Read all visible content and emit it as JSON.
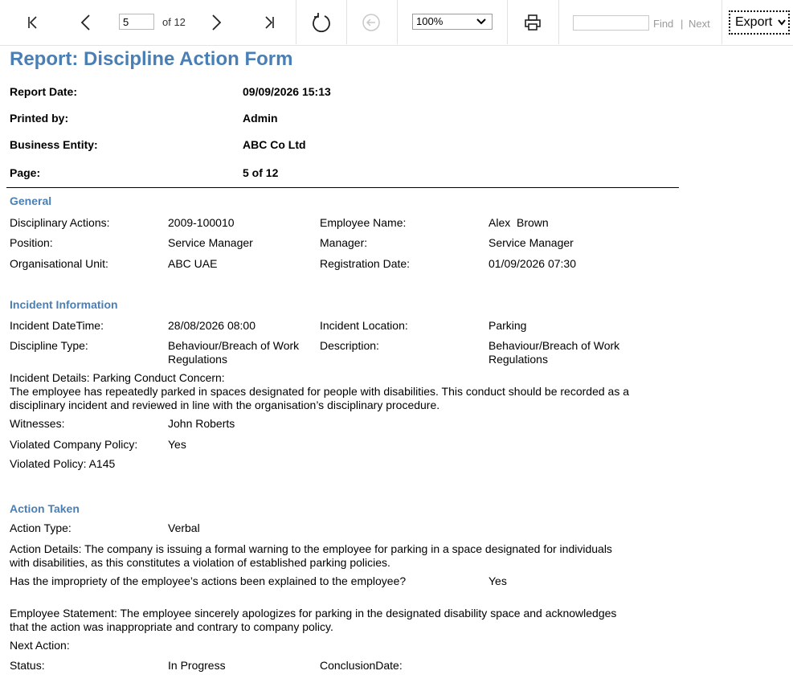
{
  "toolbar": {
    "current_page": "5",
    "page_of": "of 12",
    "zoom": "100%",
    "find_label": "Find",
    "find_separator": "|",
    "next_label": "Next",
    "export_label": "Export"
  },
  "report": {
    "title": "Report: Discipline Action Form",
    "meta": [
      {
        "label": "Report Date:",
        "value": "09/09/2026 15:13"
      },
      {
        "label": "Printed by:",
        "value": "Admin"
      },
      {
        "label": "Business Entity:",
        "value": "ABC Co Ltd"
      },
      {
        "label": "Page:",
        "value": "5 of 12"
      }
    ],
    "general": {
      "heading": "General",
      "disciplinary_actions_label": "Disciplinary Actions:",
      "disciplinary_actions_value": "2009-100010",
      "employee_name_label": "Employee Name:",
      "employee_name_value": "Alex  Brown",
      "position_label": "Position:",
      "position_value": "Service Manager",
      "manager_label": "Manager:",
      "manager_value": "Service Manager",
      "org_unit_label": "Organisational Unit:",
      "org_unit_value": "ABC UAE",
      "registration_date_label": "Registration Date:",
      "registration_date_value": "01/09/2026 07:30"
    },
    "incident": {
      "heading": "Incident Information",
      "datetime_label": "Incident DateTime:",
      "datetime_value": "28/08/2026 08:00",
      "location_label": "Incident Location:",
      "location_value": "Parking",
      "discipline_type_label": "Discipline Type:",
      "discipline_type_value_1": "Behaviour/Breach of Work",
      "discipline_type_value_2": "Regulations",
      "description_label": "Description:",
      "description_value_1": "Behaviour/Breach of Work",
      "description_value_2": "Regulations",
      "details_line_1": "Incident Details: Parking Conduct Concern:",
      "details_line_2": "The employee has repeatedly parked in spaces designated for people with disabilities. This conduct should be recorded as a",
      "details_line_3": "disciplinary incident and reviewed in line with the organisation’s disciplinary procedure.",
      "witnesses_label": "Witnesses:",
      "witnesses_value": "John Roberts",
      "violated_company_policy_label": "Violated Company Policy:",
      "violated_company_policy_value": "Yes",
      "violated_policy": "Violated Policy: A145"
    },
    "action": {
      "heading": "Action Taken",
      "action_type_label": "Action Type:",
      "action_type_value": "Verbal",
      "details_line_1": "Action Details: The company is issuing a formal warning to the employee for parking in a space designated for individuals",
      "details_line_2": "with disabilities, as this constitutes a violation of established parking policies.",
      "explained_label": "Has the impropriety of the employee’s actions been explained to the employee?",
      "explained_value": "Yes",
      "statement_line_1": "Employee Statement: The employee sincerely apologizes for parking in the designated disability space and acknowledges",
      "statement_line_2": "that the action was inappropriate and contrary to company policy.",
      "next_action_label": "Next Action:",
      "status_label": "Status:",
      "status_value": "In Progress",
      "conclusion_date_label": "ConclusionDate:"
    }
  },
  "colors": {
    "heading": "#4a7fb5",
    "disabled_icon": "#c8c8c8"
  },
  "icons": [
    "first-page-icon",
    "previous-page-icon",
    "next-page-icon",
    "last-page-icon",
    "refresh-icon",
    "back-to-parent-icon",
    "chevron-down-icon",
    "print-icon"
  ]
}
